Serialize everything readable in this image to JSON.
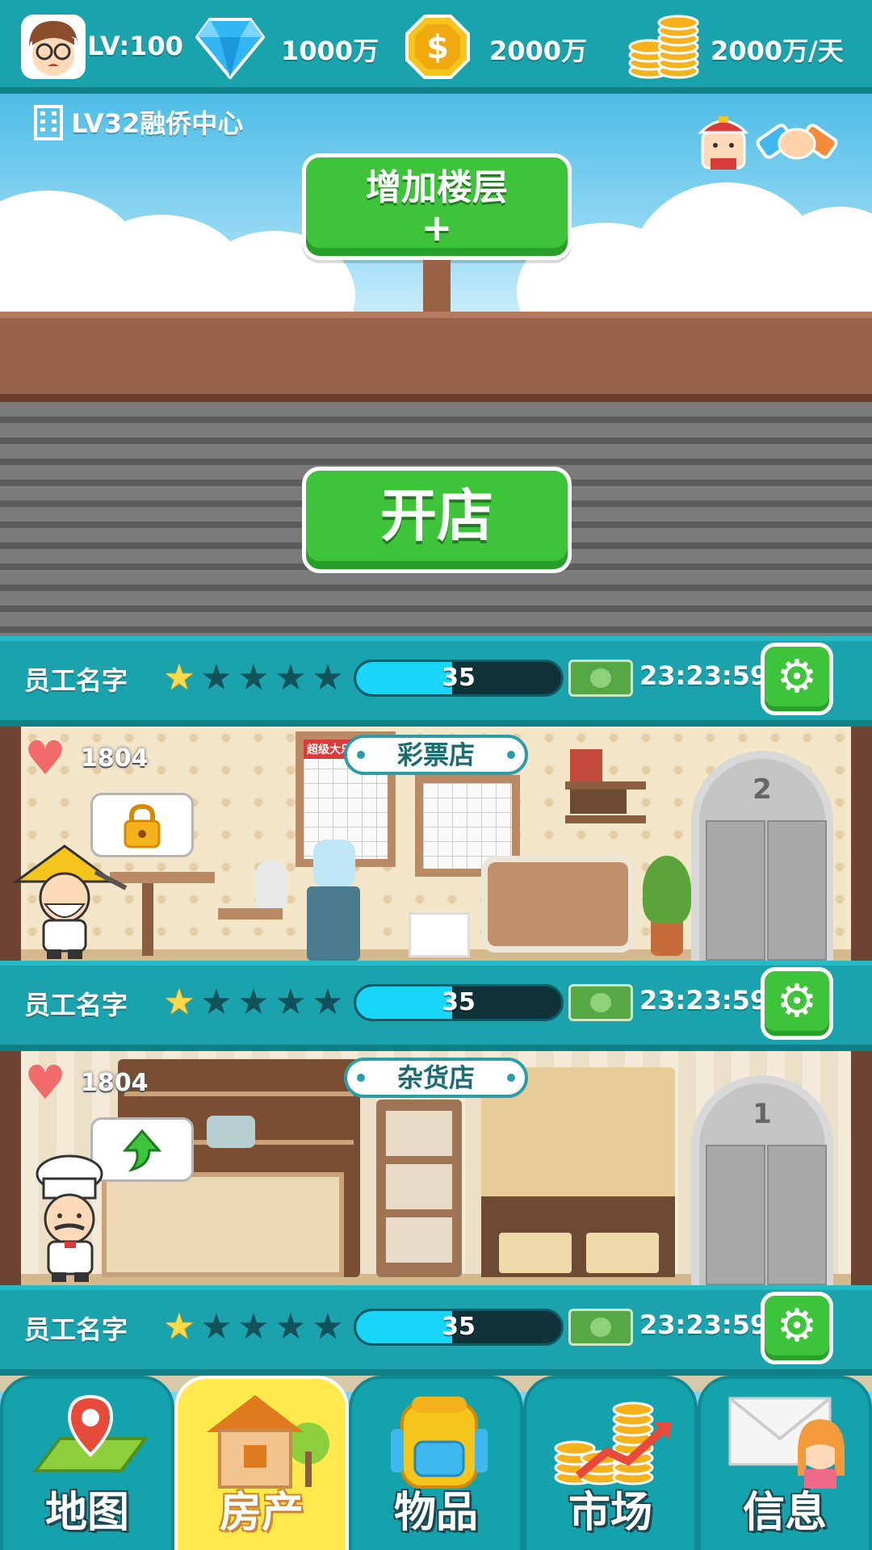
{
  "status": {
    "level": "LV:100",
    "diamonds": "1000万",
    "coins": "2000万",
    "income": "2000万/天"
  },
  "building": {
    "name": "LV32融侨中心",
    "add_floor_label": "增加楼层",
    "add_floor_plus": "+"
  },
  "locked_floor": {
    "open_label": "开店"
  },
  "rows": [
    {
      "employee": "员工名字",
      "stars": 1,
      "progress_value": "35",
      "progress": 0.47,
      "timer": "23:23:59"
    },
    {
      "employee": "员工名字",
      "stars": 1,
      "progress_value": "35",
      "progress": 0.47,
      "timer": "23:23:59"
    },
    {
      "employee": "员工名字",
      "stars": 1,
      "progress_value": "35",
      "progress": 0.47,
      "timer": "23:23:59"
    }
  ],
  "shops": [
    {
      "name": "彩票店",
      "likes": "1804",
      "board_title": "超级大乐透",
      "elevator_floor": "2",
      "bubble_icon": "lock-icon"
    },
    {
      "name": "杂货店",
      "likes": "1804",
      "elevator_floor": "1",
      "bubble_icon": "upgrade-arrow-icon"
    }
  ],
  "nav": [
    {
      "label": "地图",
      "icon": "map-icon",
      "active": false
    },
    {
      "label": "房产",
      "icon": "house-icon",
      "active": true
    },
    {
      "label": "物品",
      "icon": "backpack-icon",
      "active": false
    },
    {
      "label": "市场",
      "icon": "coins-chart-icon",
      "active": false
    },
    {
      "label": "信息",
      "icon": "mail-icon",
      "active": false
    }
  ],
  "colors": {
    "teal": "#1aa3ad",
    "green_button": "#3ec43a",
    "active_tab": "#ffe94d",
    "progress_fill": "#18d6f8"
  }
}
